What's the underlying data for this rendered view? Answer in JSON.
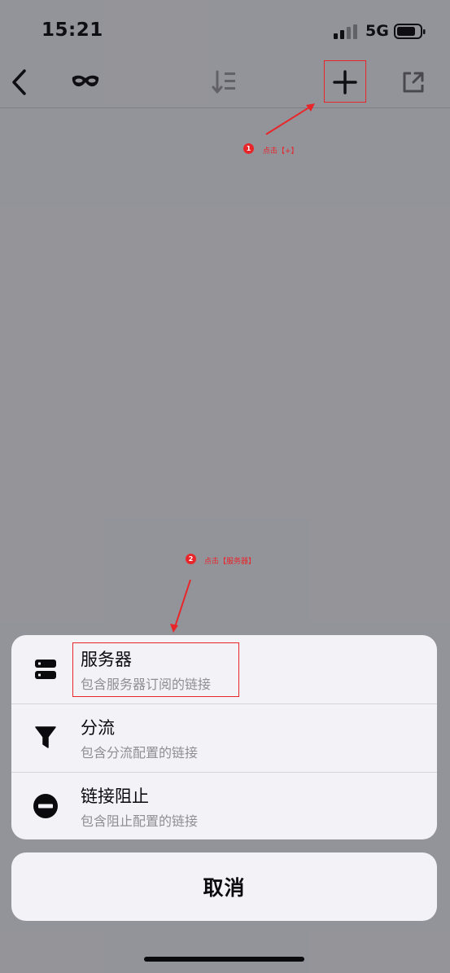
{
  "status_bar": {
    "time": "15:21",
    "network": "5G"
  },
  "nav": {
    "back_icon": "chevron-left-icon",
    "mask_icon": "mask-icon",
    "sort_icon": "sort-icon",
    "add_icon": "plus-icon",
    "share_icon": "external-link-icon"
  },
  "annotations": [
    {
      "number": "1",
      "text": "点击【+】"
    },
    {
      "number": "2",
      "text": "点击【服务器】"
    }
  ],
  "sheet": {
    "items": [
      {
        "icon": "server-icon",
        "title": "服务器",
        "subtitle": "包含服务器订阅的链接"
      },
      {
        "icon": "filter-icon",
        "title": "分流",
        "subtitle": "包含分流配置的链接"
      },
      {
        "icon": "block-icon",
        "title": "链接阻止",
        "subtitle": "包含阻止配置的链接"
      }
    ],
    "cancel_label": "取消"
  },
  "colors": {
    "annotation": "#e8262a",
    "overlay": "#8f8e93",
    "sheet_bg": "#f2f2f7"
  }
}
